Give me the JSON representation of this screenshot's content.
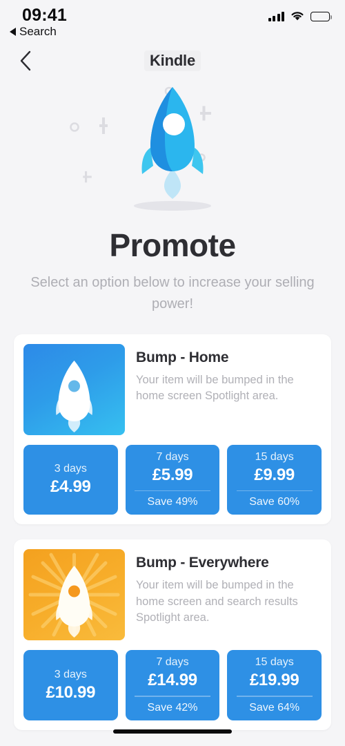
{
  "status_bar": {
    "time": "09:41",
    "back_app_label": "Search",
    "icons": {
      "signal": "signal-bars-icon",
      "wifi": "wifi-icon",
      "battery": "battery-full-icon"
    }
  },
  "nav": {
    "back_icon": "chevron-left-icon",
    "title": "Kindle"
  },
  "hero": {
    "illustration": "rocket-illustration",
    "title": "Promote",
    "subtitle": "Select an option below to increase your selling power!"
  },
  "colors": {
    "accent_blue": "#2e90e5",
    "thumb_blue_start": "#2d8ae8",
    "thumb_blue_end": "#36c0f0",
    "thumb_orange_start": "#f4a11f",
    "thumb_orange_end": "#f9bb3c",
    "page_background": "#f5f5f7",
    "card_background": "#ffffff",
    "title_text": "#2e2e33",
    "muted_text": "#b0b0b6"
  },
  "cards": [
    {
      "icon": "rocket-blue-icon",
      "title": "Bump - Home",
      "description": "Your item will be bumped in the home screen Spotlight area.",
      "options": [
        {
          "days": "3 days",
          "price": "£4.99",
          "save": ""
        },
        {
          "days": "7 days",
          "price": "£5.99",
          "save": "Save 49%"
        },
        {
          "days": "15 days",
          "price": "£9.99",
          "save": "Save 60%"
        }
      ]
    },
    {
      "icon": "rocket-orange-icon",
      "title": "Bump - Everywhere",
      "description": "Your item will be bumped in the home screen and search results Spotlight area.",
      "options": [
        {
          "days": "3 days",
          "price": "£10.99",
          "save": ""
        },
        {
          "days": "7 days",
          "price": "£14.99",
          "save": "Save 42%"
        },
        {
          "days": "15 days",
          "price": "£19.99",
          "save": "Save 64%"
        }
      ]
    }
  ],
  "home_indicator": "home-indicator"
}
